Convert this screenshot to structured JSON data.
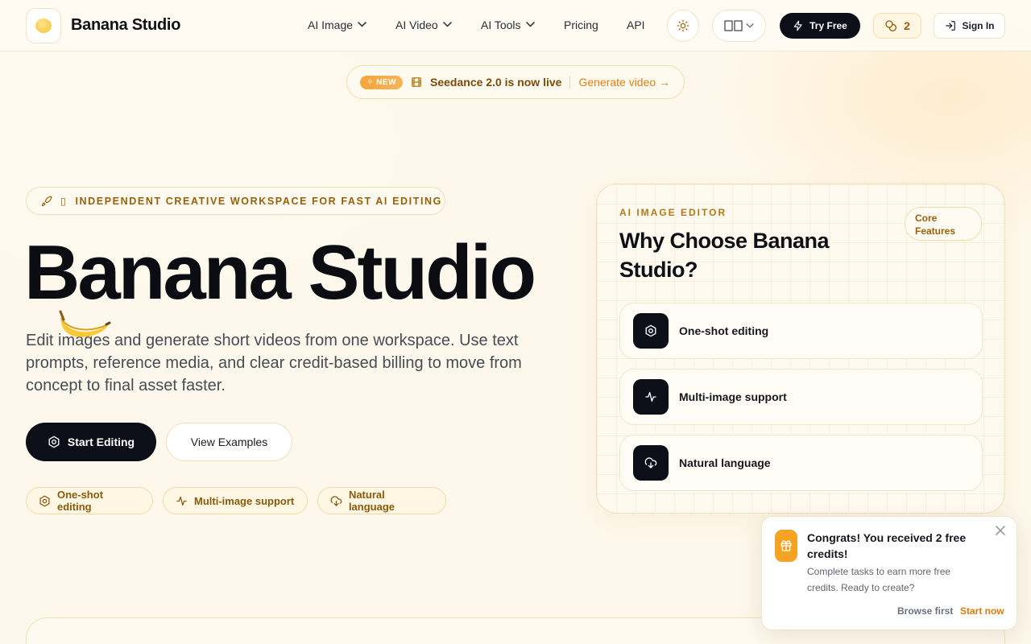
{
  "header": {
    "brand": "Banana Studio",
    "nav": [
      {
        "label": "AI Image",
        "dropdown": true
      },
      {
        "label": "AI Video",
        "dropdown": true
      },
      {
        "label": "AI Tools",
        "dropdown": true
      },
      {
        "label": "Pricing",
        "dropdown": false
      },
      {
        "label": "API",
        "dropdown": false
      }
    ],
    "try_free": "Try Free",
    "credits": "2",
    "sign_in": "Sign In"
  },
  "announcement": {
    "badge": "NEW",
    "text": "Seedance 2.0 is now live",
    "link": "Generate video →"
  },
  "hero": {
    "eyebrow": "INDEPENDENT CREATIVE WORKSPACE FOR FAST AI EDITING",
    "eyebrow_glyph": "▯",
    "title": "Banana Studio",
    "description": "Edit images and generate short videos from one workspace. Use text prompts, reference media, and clear credit-based billing to move from concept to final asset faster.",
    "primary_cta": "Start Editing",
    "secondary_cta": "View Examples",
    "chips": [
      "One-shot editing",
      "Multi-image support",
      "Natural language"
    ]
  },
  "card": {
    "eyebrow": "AI IMAGE EDITOR",
    "title": "Why Choose Banana Studio?",
    "badge": "Core Features",
    "features": [
      {
        "label": "One-shot editing",
        "icon": "aperture-icon"
      },
      {
        "label": "Multi-image support",
        "icon": "activity-icon"
      },
      {
        "label": "Natural language",
        "icon": "cloud-download-icon"
      }
    ]
  },
  "toast": {
    "title": "Congrats! You received 2 free credits!",
    "body": "Complete tasks to earn more free credits. Ready to create?",
    "browse": "Browse first",
    "start": "Start now"
  },
  "colors": {
    "background": "#fef8ec",
    "primary_dark": "#0c0f17",
    "accent_orange": "#f4a322",
    "accent_brown": "#96600a"
  }
}
